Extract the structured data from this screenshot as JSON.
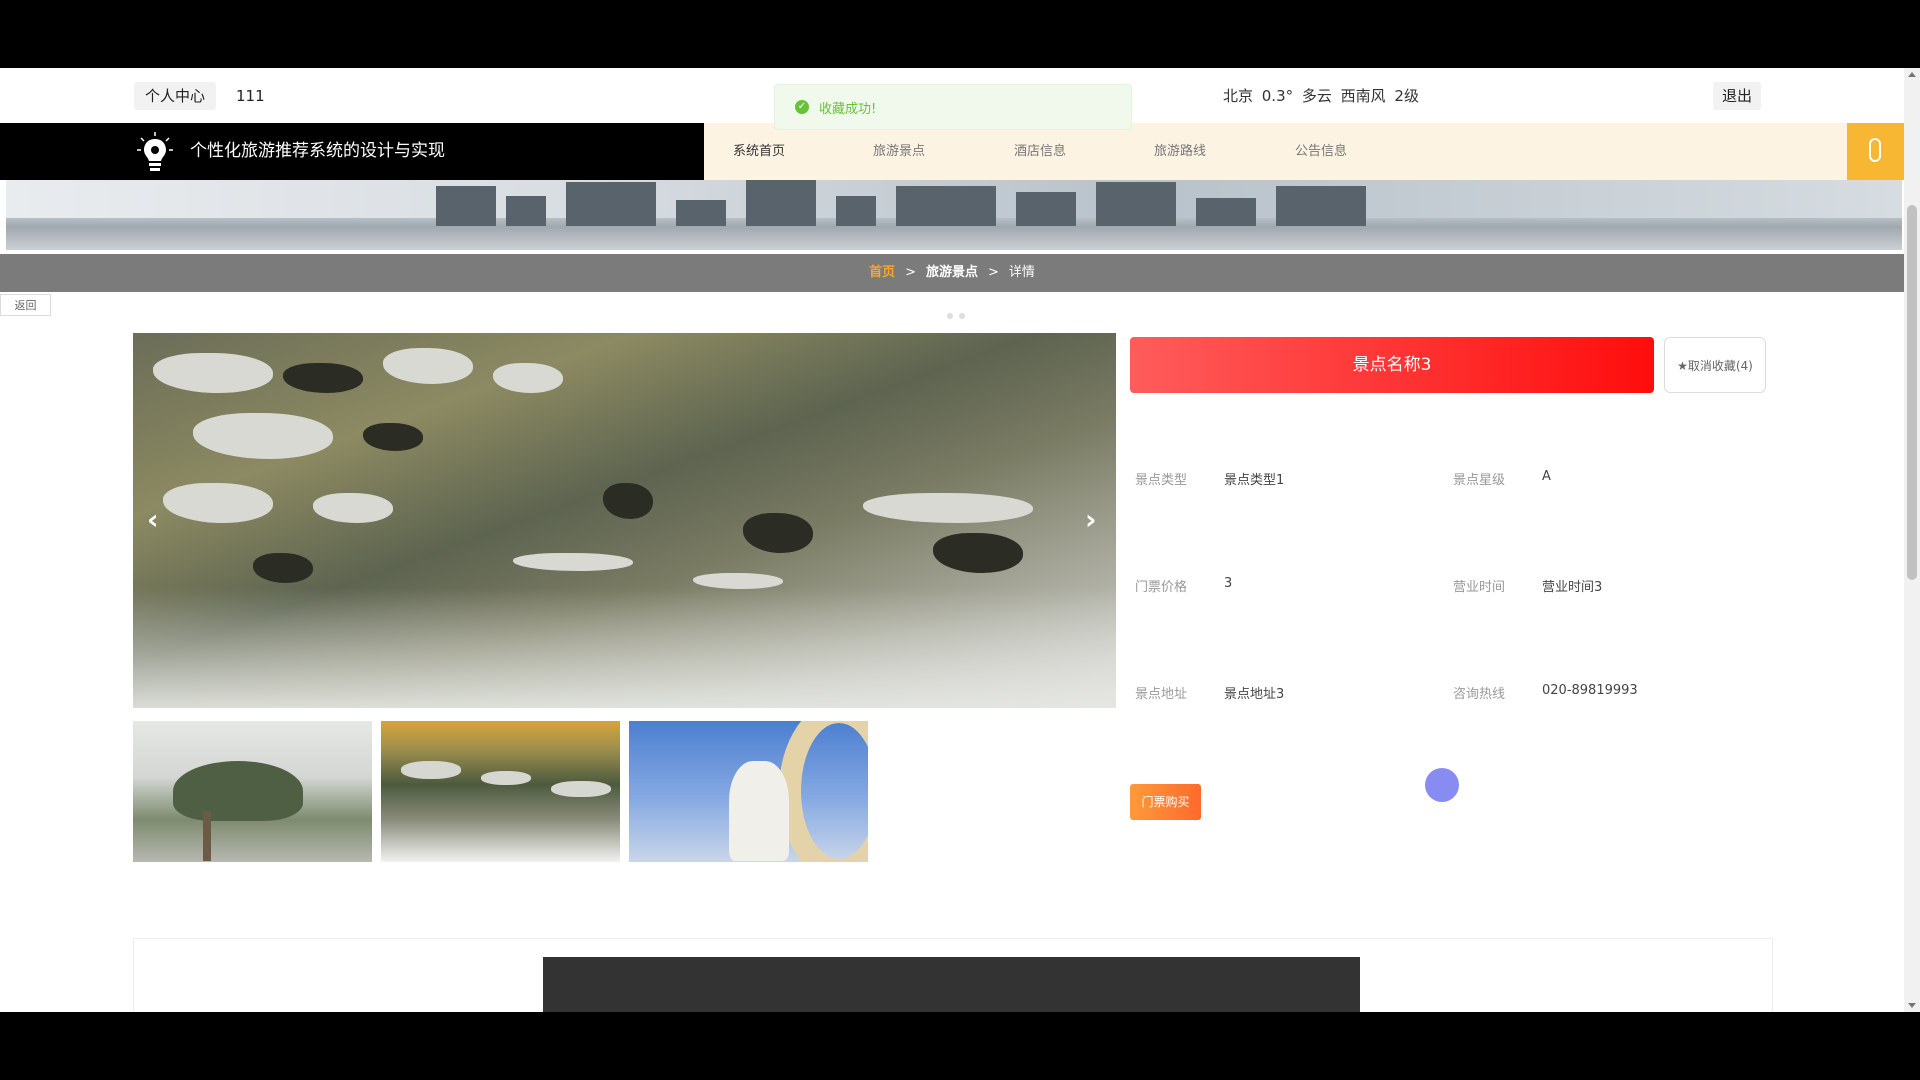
{
  "topbar": {
    "personal_center": "个人中心",
    "username": "111",
    "weather": "北京 0.3° 多云 西南风 2级",
    "logout": "退出"
  },
  "toast": {
    "message": "收藏成功!"
  },
  "header": {
    "site_title": "个性化旅游推荐系统的设计与实现",
    "nav": [
      "系统首页",
      "旅游景点",
      "酒店信息",
      "旅游路线",
      "公告信息"
    ]
  },
  "breadcrumb": {
    "home": "首页",
    "section": "旅游景点",
    "current": "详情",
    "sep": ">"
  },
  "back": "返回",
  "detail": {
    "name": "景点名称3",
    "favorite": "★取消收藏(4)",
    "fields": [
      {
        "label": "景点类型",
        "value": "景点类型1"
      },
      {
        "label": "景点星级",
        "value": "A"
      },
      {
        "label": "门票价格",
        "value": "3"
      },
      {
        "label": "营业时间",
        "value": "营业时间3"
      },
      {
        "label": "景点地址",
        "value": "景点地址3"
      },
      {
        "label": "咨询热线",
        "value": "020-89819993"
      }
    ],
    "buy": "门票购买"
  },
  "carousel": {
    "prev_icon": "chevron-left-icon",
    "next_icon": "chevron-right-icon",
    "slide_count": 3,
    "active_slide": 1
  },
  "colors": {
    "accent": "#f7b732",
    "name_bar_start": "#ff5c5c",
    "name_bar_end": "#ff0d0d",
    "buy": "#ff7a2f",
    "success": "#67c23a"
  }
}
